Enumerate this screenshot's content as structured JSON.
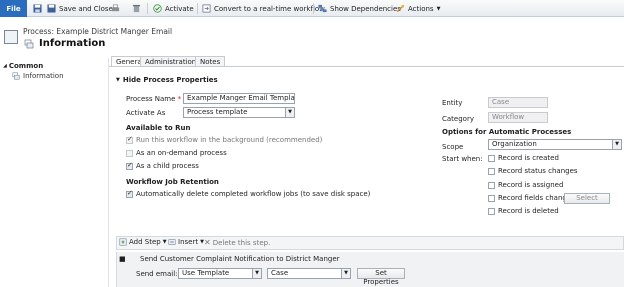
{
  "ribbon": {
    "file": "File",
    "save_and_close": "Save and Close",
    "activate": "Activate",
    "convert": "Convert to a real-time workflow",
    "show_dependencies": "Show Dependencies",
    "actions": "Actions"
  },
  "header": {
    "breadcrumb": "Process: Example District Manger Email",
    "title": "Information"
  },
  "nav": {
    "section": "Common",
    "item": "Information"
  },
  "tabs": [
    "General",
    "Administration",
    "Notes"
  ],
  "section_toggle": "Hide Process Properties",
  "form": {
    "process_name_label": "Process Name",
    "process_name_value": "Example Manger Email Template",
    "activate_as_label": "Activate As",
    "activate_as_value": "Process template",
    "available_to_run": "Available to Run",
    "opt_background": "Run this workflow in the background (recommended)",
    "opt_on_demand": "As an on-demand process",
    "opt_child": "As a child process",
    "retention_heading": "Workflow Job Retention",
    "opt_auto_delete": "Automatically delete completed workflow jobs (to save disk space)"
  },
  "right": {
    "entity_label": "Entity",
    "entity_value": "Case",
    "category_label": "Category",
    "category_value": "Workflow",
    "options_heading": "Options for Automatic Processes",
    "scope_label": "Scope",
    "scope_value": "Organization",
    "start_when_label": "Start when:",
    "triggers": [
      "Record is created",
      "Record status changes",
      "Record is assigned",
      "Record fields change",
      "Record is deleted"
    ],
    "select_button": "Select"
  },
  "steps": {
    "add_step": "Add Step",
    "insert": "Insert",
    "delete": "Delete this step.",
    "step_title": "Send Customer Complaint Notification to District Manger",
    "send_email_label": "Send email:",
    "send_email_mode": "Use Template",
    "send_email_entity": "Case",
    "set_properties": "Set Properties"
  }
}
